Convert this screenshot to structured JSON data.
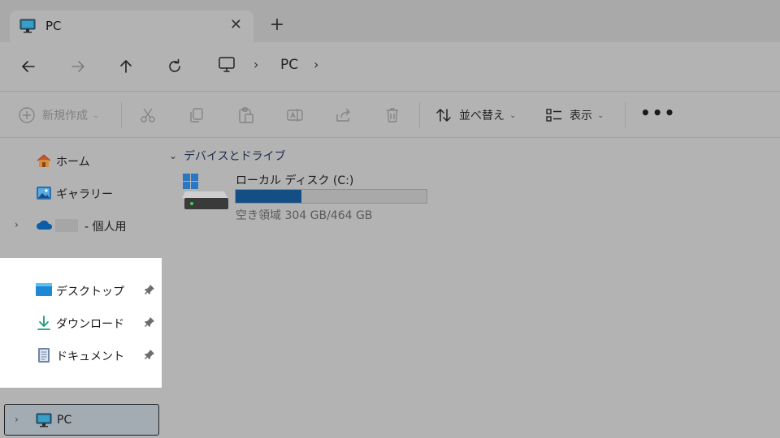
{
  "tab": {
    "title": "PC",
    "close_symbol": "✕",
    "new_tab_symbol": "+"
  },
  "address": {
    "chevron": "›",
    "crumb": "PC"
  },
  "commands": {
    "new_label": "新規作成",
    "sort_label": "並べ替え",
    "view_label": "表示",
    "dropdown_symbol": "⌄",
    "more_symbol": "•••"
  },
  "sidebar": {
    "items": [
      {
        "label": "ホーム"
      },
      {
        "label": "ギャラリー"
      },
      {
        "label": "- 個人用"
      }
    ],
    "quick_access": [
      {
        "label": "デスクトップ"
      },
      {
        "label": "ダウンロード"
      },
      {
        "label": "ドキュメント"
      }
    ],
    "pc_label": "PC",
    "expander_symbol": "›"
  },
  "content": {
    "group_chevron": "⌄",
    "group_title": "デバイスとドライブ",
    "drive": {
      "name": "ローカル ディスク (C:)",
      "space_text": "空き領域 304 GB/464 GB",
      "used_fraction": 0.345
    }
  },
  "colors": {
    "drive_bar_fill": "#134f85",
    "pc_selected_bg": "#a3acb3",
    "quick_panel_bg": "#ffffff",
    "onedrive_blue": "#0a5ea8"
  },
  "icons": [
    "monitor-icon",
    "close-icon",
    "plus-icon",
    "arrow-left-icon",
    "arrow-right-icon",
    "arrow-up-icon",
    "refresh-icon",
    "chevron-right-icon",
    "plus-circle-icon",
    "cut-icon",
    "copy-icon",
    "paste-icon",
    "rename-icon",
    "share-icon",
    "trash-icon",
    "sort-icon",
    "view-icon",
    "more-icon",
    "home-icon",
    "gallery-icon",
    "onedrive-icon",
    "desktop-icon",
    "download-icon",
    "document-icon",
    "pin-icon",
    "drive-icon"
  ]
}
